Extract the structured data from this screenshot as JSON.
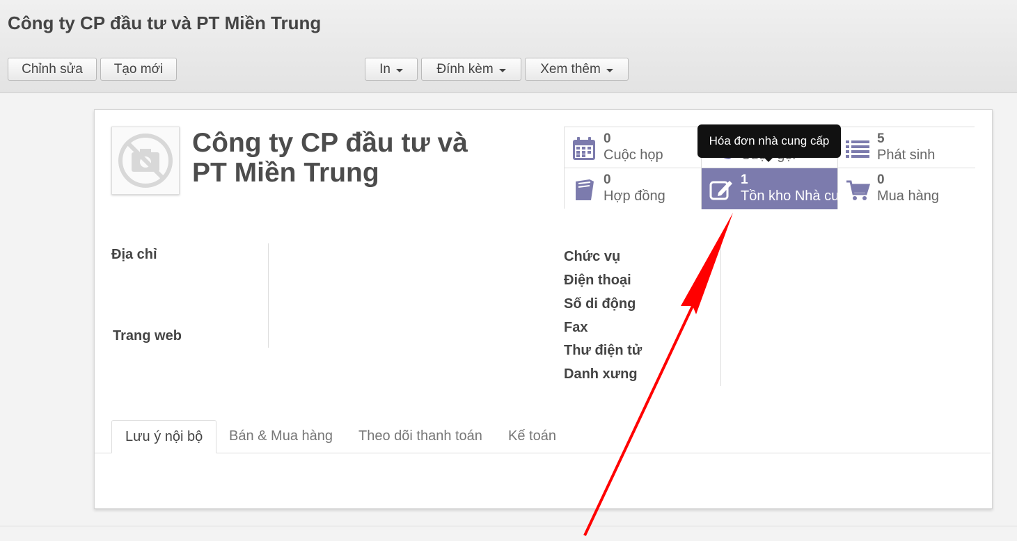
{
  "header": {
    "title": "Công ty CP đầu tư và PT Miền Trung",
    "buttons": {
      "edit": "Chỉnh sửa",
      "create": "Tạo mới"
    },
    "dropdowns": {
      "print": "In",
      "attach": "Đính kèm",
      "more": "Xem thêm"
    }
  },
  "partner": {
    "name_line1": "Công ty CP đầu tư và",
    "name_line2": "PT Miền Trung"
  },
  "smart_buttons": [
    {
      "value": "0",
      "label": "Cuộc họp",
      "icon": "calendar-icon"
    },
    {
      "value": "",
      "label": "Cuộc gọi",
      "icon": "phone-icon"
    },
    {
      "value": "5",
      "label": "Phát sinh",
      "icon": "list-icon"
    },
    {
      "value": "0",
      "label": "Hợp đồng",
      "icon": "book-icon"
    },
    {
      "value": "1",
      "label": "Tồn kho Nhà cung cấp",
      "icon": "edit-icon"
    },
    {
      "value": "0",
      "label": "Mua hàng",
      "icon": "cart-icon"
    }
  ],
  "tooltip": "Hóa đơn nhà cung cấp",
  "fields_left": {
    "address": "Địa chỉ",
    "website": "Trang web"
  },
  "fields_right": {
    "function": "Chức vụ",
    "phone": "Điện thoại",
    "mobile": "Số di động",
    "fax": "Fax",
    "email": "Thư điện tử",
    "title": "Danh xưng"
  },
  "tabs": [
    "Lưu ý nội bộ",
    "Bán & Mua hàng",
    "Theo dõi thanh toán",
    "Kế toán"
  ],
  "colors": {
    "accent": "#7c7bad",
    "annotation_arrow": "#ff0000"
  }
}
